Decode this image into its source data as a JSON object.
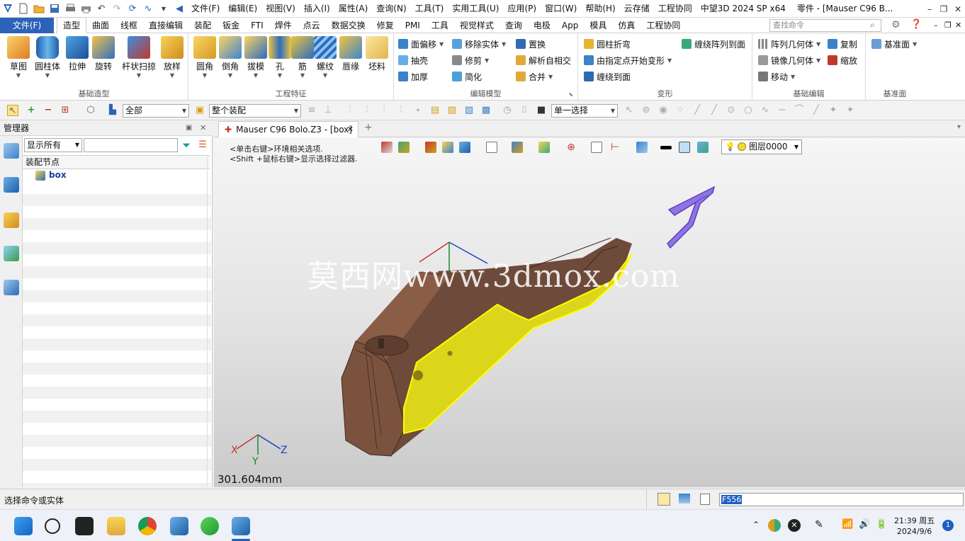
{
  "app": {
    "title": "中望3D 2024 SP x64",
    "doc_title": "零件 - [Mauser C96 B...",
    "menus": [
      "文件(F)",
      "编辑(E)",
      "视图(V)",
      "插入(I)",
      "属性(A)",
      "查询(N)",
      "工具(T)",
      "实用工具(U)",
      "应用(P)",
      "窗口(W)",
      "帮助(H)",
      "云存储",
      "工程协同"
    ]
  },
  "ribbon": {
    "file_label": "文件(F)",
    "tabs": [
      "造型",
      "曲面",
      "线框",
      "直接编辑",
      "装配",
      "钣金",
      "FTI",
      "焊件",
      "点云",
      "数据交换",
      "修复",
      "PMI",
      "工具",
      "视觉样式",
      "查询",
      "电极",
      "App",
      "模具",
      "仿真",
      "工程协同"
    ],
    "search_placeholder": "查找命令",
    "groups": {
      "basic": {
        "label": "基础造型",
        "buttons": [
          "草图",
          "圆柱体",
          "拉伸",
          "旋转",
          "杆状扫掠",
          "放样"
        ]
      },
      "eng": {
        "label": "工程特征",
        "buttons": [
          "圆角",
          "倒角",
          "拔模",
          "孔",
          "筋",
          "螺纹",
          "唇缘",
          "坯料"
        ]
      },
      "edit": {
        "label": "编辑模型",
        "items": [
          "面偏移",
          "移除实体",
          "置换",
          "抽壳",
          "修剪",
          "解析自相交",
          "加厚",
          "简化",
          "合并"
        ]
      },
      "deform": {
        "label": "变形",
        "items": [
          "圆柱折弯",
          "缠绕阵列到面",
          "由指定点开始变形",
          "缠绕到面"
        ]
      },
      "basicedit": {
        "label": "基础编辑",
        "items": [
          "阵列几何体",
          "复制",
          "镜像几何体",
          "缩放",
          "移动"
        ]
      },
      "datum": {
        "label": "基准面",
        "items": [
          "基准面"
        ]
      }
    },
    "colors": {
      "file_blue": "#2c63b8"
    }
  },
  "toolbar": {
    "filter_all": "全部",
    "assembly_scope": "整个装配",
    "select_mode": "单一选择"
  },
  "manager": {
    "title": "管理器",
    "show_filter": "显示所有",
    "tree_header": "装配节点",
    "root_node": "box"
  },
  "viewport": {
    "tab_label": "Mauser C96 Bolo.Z3 - [box]",
    "hint_line1": "<单击右键>环境相关选项.",
    "hint_line2": "<Shift +鼠标右键>显示选择过滤器.",
    "layer_label": "图层0000",
    "watermark": "莫西网www.3dmox.com",
    "measure": "301.604mm",
    "axis": {
      "x": "X",
      "y": "Y",
      "z": "Z"
    }
  },
  "statusbar": {
    "prompt": "选择命令或实体",
    "cmd_value": "F556"
  },
  "taskbar": {
    "time": "21:39 周五",
    "date": "2024/9/6",
    "notif_count": "1"
  }
}
